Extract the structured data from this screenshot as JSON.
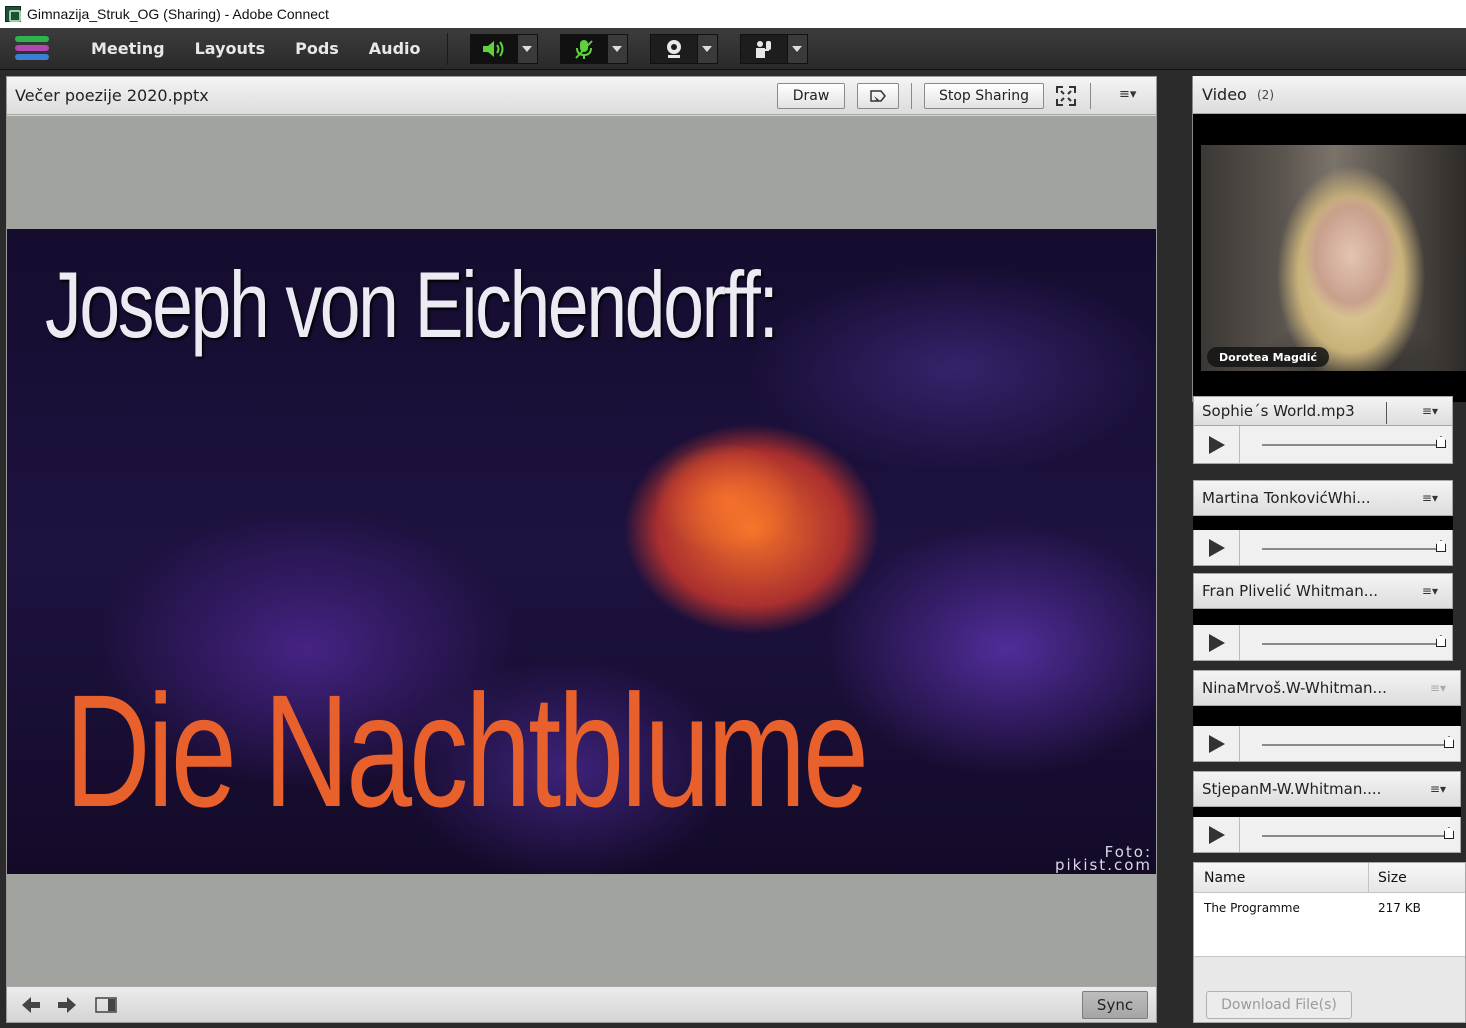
{
  "window": {
    "title": "Gimnazija_Struk_OG (Sharing) - Adobe Connect"
  },
  "menubar": {
    "items": [
      "Meeting",
      "Layouts",
      "Pods",
      "Audio"
    ],
    "tools": [
      {
        "icon": "speaker-icon",
        "active": true
      },
      {
        "icon": "microphone-muted-icon",
        "active": true
      },
      {
        "icon": "webcam-icon",
        "active": false
      },
      {
        "icon": "raise-hand-icon",
        "active": false
      }
    ],
    "accent": "#5fd13b"
  },
  "share": {
    "document": "Večer poezije 2020.pptx",
    "draw_label": "Draw",
    "stop_label": "Stop Sharing",
    "sync_label": "Sync",
    "slide": {
      "title": "Joseph von Eichendorff:",
      "subtitle": "Die Nachtblume",
      "credit_line1": "Foto:",
      "credit_line2": "pikist.com",
      "title_color": "#ecebf3",
      "subtitle_color": "#e8602c"
    }
  },
  "video": {
    "title": "Video",
    "count": "(2)",
    "participant": "Dorotea Magdić"
  },
  "audio_pods": [
    {
      "name": "Sophie´s World.mp3"
    },
    {
      "name": "Martina TonkovićWhi..."
    },
    {
      "name": "Fran Plivelić Whitman..."
    },
    {
      "name": "NinaMrvoš.W-Whitman..."
    },
    {
      "name": "StjepanM-W.Whitman...."
    }
  ],
  "files": {
    "headers": {
      "name": "Name",
      "size": "Size"
    },
    "rows": [
      {
        "name": "The Programme",
        "size": "217 KB"
      }
    ],
    "download_label": "Download File(s)"
  }
}
